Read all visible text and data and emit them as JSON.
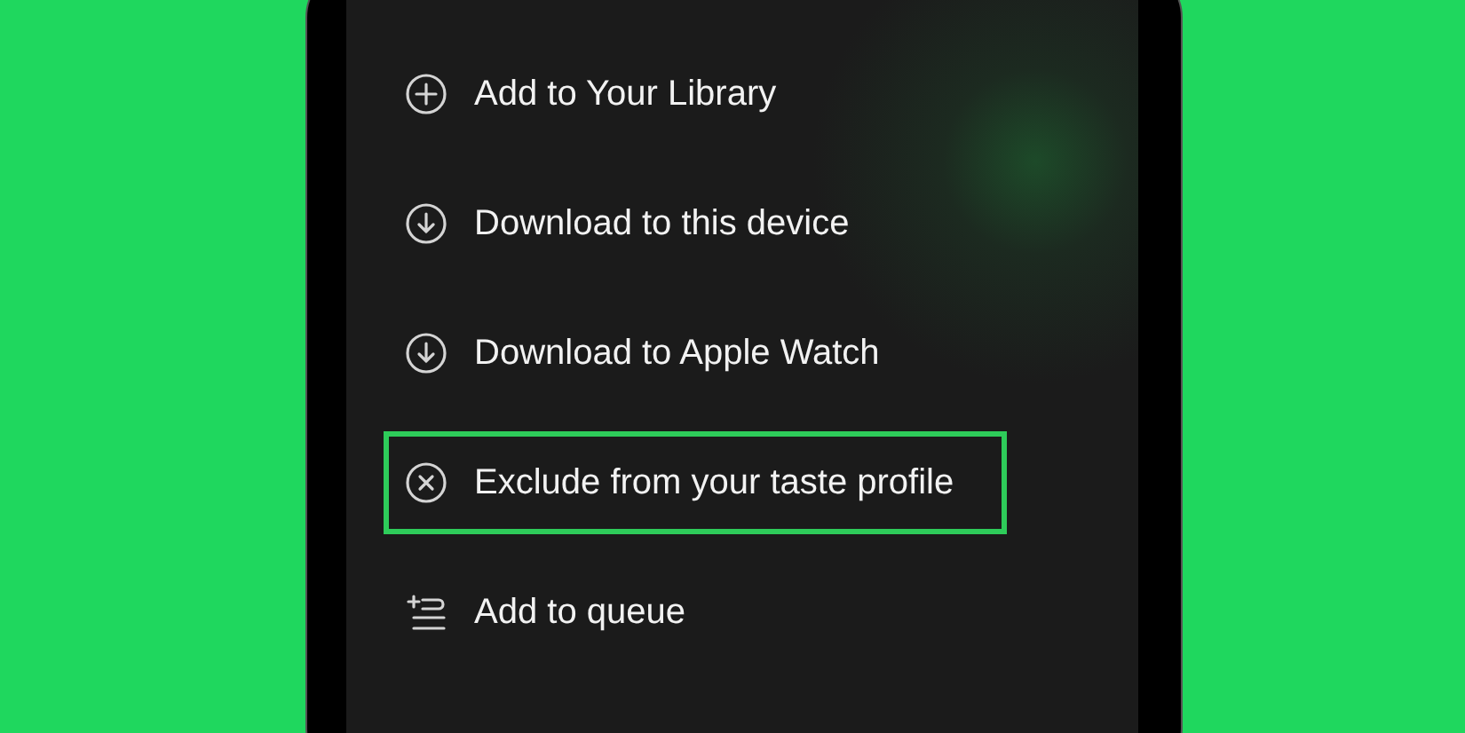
{
  "menu": {
    "items": [
      {
        "kind": "add",
        "label": "Add to Your Library",
        "highlighted": false
      },
      {
        "kind": "download",
        "label": "Download to this device",
        "highlighted": false
      },
      {
        "kind": "download",
        "label": "Download to Apple Watch",
        "highlighted": false
      },
      {
        "kind": "exclude",
        "label": "Exclude from your taste profile",
        "highlighted": true
      },
      {
        "kind": "queue",
        "label": "Add to queue",
        "highlighted": false
      }
    ]
  }
}
